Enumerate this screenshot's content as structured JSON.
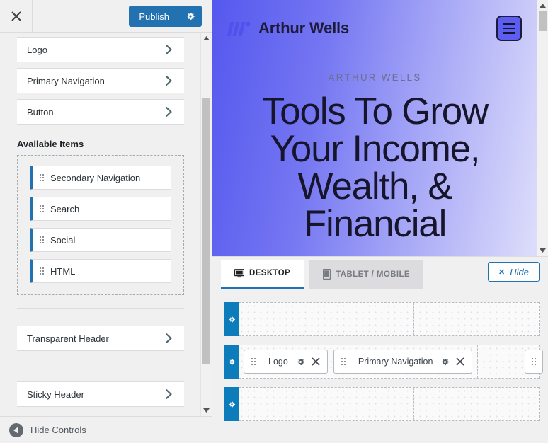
{
  "sidebar": {
    "header": {
      "close_icon": "close-icon",
      "publish_label": "Publish",
      "publish_gear_icon": "gear-icon"
    },
    "panel_rows": [
      {
        "label": "Logo",
        "chevron_icon": "chevron-right-icon"
      },
      {
        "label": "Primary Navigation",
        "chevron_icon": "chevron-right-icon"
      },
      {
        "label": "Button",
        "chevron_icon": "chevron-right-icon"
      }
    ],
    "available_items_title": "Available Items",
    "available_items": [
      {
        "label": "Secondary Navigation",
        "grip_icon": "drag-handle-icon"
      },
      {
        "label": "Search",
        "grip_icon": "drag-handle-icon"
      },
      {
        "label": "Social",
        "grip_icon": "drag-handle-icon"
      },
      {
        "label": "HTML",
        "grip_icon": "drag-handle-icon"
      }
    ],
    "bottom_rows": [
      {
        "label": "Transparent Header",
        "chevron_icon": "chevron-right-icon"
      },
      {
        "label": "Sticky Header",
        "chevron_icon": "chevron-right-icon"
      }
    ],
    "footer": {
      "label": "Hide Controls",
      "icon": "collapse-left-icon"
    },
    "scrollbar": {
      "up_icon": "scroll-up-arrow-icon",
      "down_icon": "scroll-down-arrow-icon"
    }
  },
  "preview": {
    "brand_name": "Arthur Wells",
    "logo_icon": "w-logo-icon",
    "menu_toggle_icon": "hamburger-menu-icon",
    "hero_eyebrow": "ARTHUR WELLS",
    "hero_title": "Tools To Grow Your Income, Wealth, & Financial",
    "scrollbar": {
      "up_icon": "scroll-up-arrow-icon",
      "down_icon": "scroll-down-arrow-icon"
    },
    "colors": {
      "gradient_start": "#5558ee",
      "gradient_end": "#dedefb",
      "brand_text": "#1e1b3a",
      "logo_mark": "#4f52ec",
      "menu_button_fill": "#5b5ef0"
    }
  },
  "builder": {
    "tabs": [
      {
        "label": "DESKTOP",
        "icon": "desktop-icon",
        "active": true
      },
      {
        "label": "TABLET / MOBILE",
        "icon": "mobile-device-icon",
        "active": false
      }
    ],
    "hide_button": {
      "label": "Hide",
      "icon": "close-x-icon"
    },
    "rows": [
      {
        "gear_icon": "gear-icon",
        "columns": [
          {
            "items": []
          },
          {
            "items": []
          },
          {
            "items": []
          }
        ]
      },
      {
        "gear_icon": "gear-icon",
        "columns": [
          {
            "items": [
              {
                "label": "Logo",
                "grip_icon": "drag-handle-icon",
                "gear_icon": "gear-icon",
                "remove_icon": "close-x-icon"
              },
              {
                "label": "Primary Navigation",
                "grip_icon": "drag-handle-icon",
                "gear_icon": "gear-icon",
                "remove_icon": "close-x-icon"
              }
            ]
          },
          {
            "items": []
          },
          {
            "items": []
          }
        ],
        "overflow_item": {
          "grip_icon": "drag-handle-icon"
        }
      },
      {
        "gear_icon": "gear-icon",
        "columns": [
          {
            "items": []
          },
          {
            "items": []
          },
          {
            "items": []
          }
        ]
      }
    ],
    "colors": {
      "accent": "#2271b1",
      "row_handle": "#0c7cba"
    }
  }
}
